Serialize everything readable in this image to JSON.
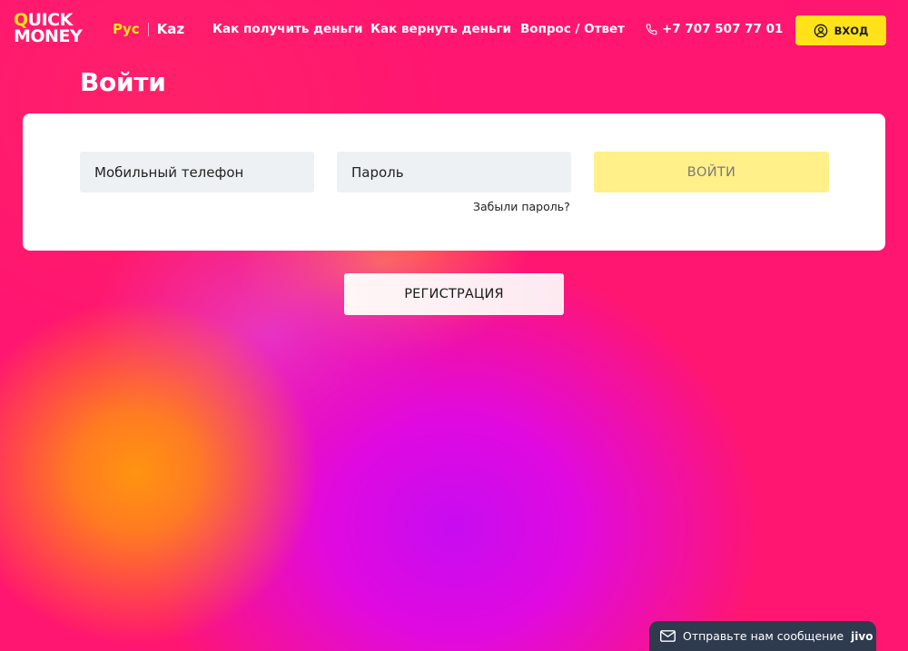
{
  "header": {
    "logo": {
      "q": "Q",
      "line1_rest": "UICK",
      "line2": "MONEY"
    },
    "lang": {
      "ru": "Рус",
      "kz": "Kaz"
    },
    "nav": [
      "Как получить деньги",
      "Как вернуть деньги",
      "Вопрос / Ответ"
    ],
    "phone": "+7 707 507 77 01",
    "login_label": "ВХОД"
  },
  "page": {
    "title": "Войти"
  },
  "form": {
    "phone_placeholder": "Мобильный телефон",
    "password_placeholder": "Пароль",
    "submit_label": "ВОЙТИ",
    "forgot_label": "Забыли пароль?"
  },
  "register_label": "РЕГИСТРАЦИЯ",
  "chat": {
    "label": "Отправьте нам сообщение",
    "brand": "jivo"
  },
  "colors": {
    "accent_yellow": "#ffe21a",
    "background_pink": "#ff1670",
    "chat_bg": "#2e3a4e"
  }
}
